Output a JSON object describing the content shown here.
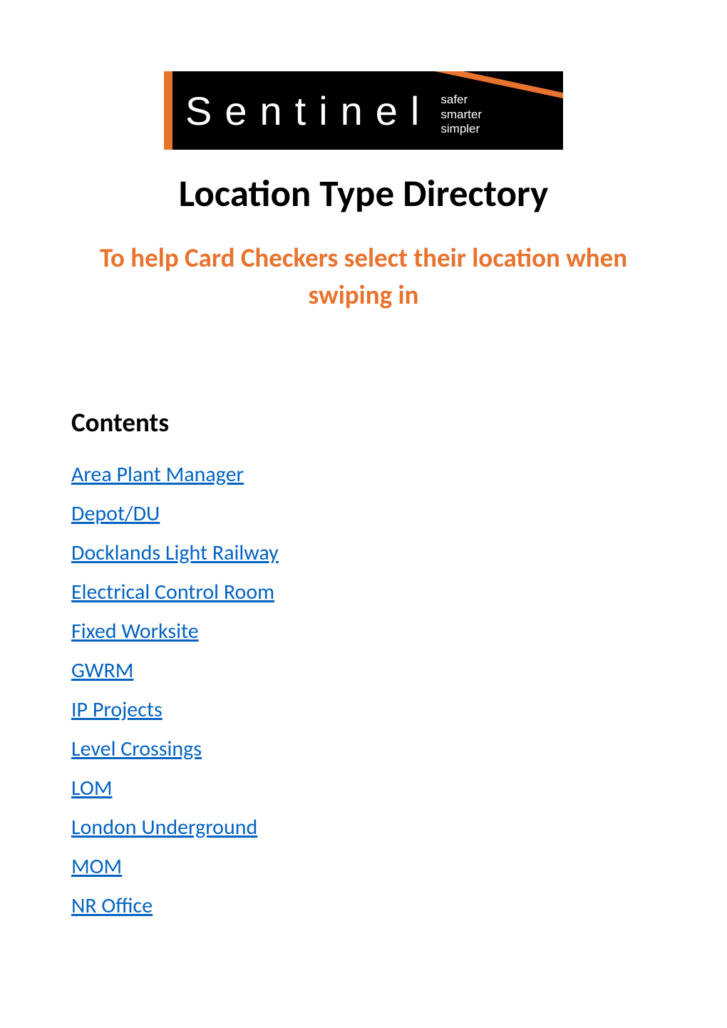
{
  "logo": {
    "main_text": "Sentinel",
    "tagline_line1": "safer",
    "tagline_line2": "smarter",
    "tagline_line3": "simpler"
  },
  "title": "Location Type Directory",
  "subtitle": "To help Card Checkers select their location when swiping in",
  "contents_heading": "Contents",
  "toc_items": [
    "Area Plant Manager",
    "Depot/DU",
    "Docklands Light Railway",
    "Electrical Control Room",
    "Fixed Worksite",
    "GWRM",
    "IP Projects",
    "Level Crossings",
    "LOM",
    "London Underground",
    "MOM",
    "NR Office"
  ]
}
